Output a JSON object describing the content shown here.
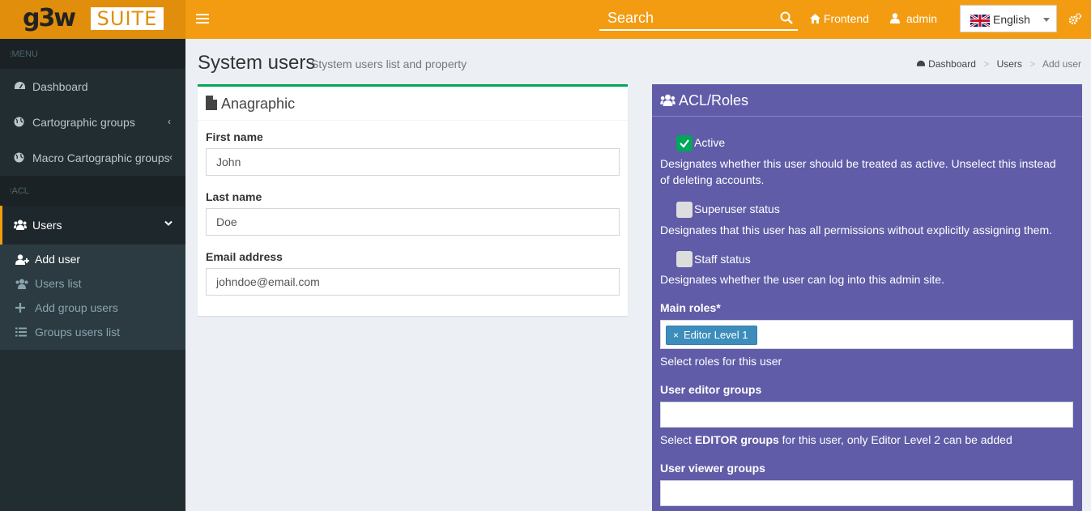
{
  "header": {
    "logo_main": "g3w",
    "logo_suite": "SUITE",
    "search_placeholder": "Search",
    "frontend_label": "Frontend",
    "user_label": "admin",
    "language": "English"
  },
  "sidebar": {
    "menu_header": "MENU",
    "acl_header": "ACL",
    "items": [
      {
        "label": "Dashboard",
        "icon": "dashboard-icon"
      },
      {
        "label": "Cartographic groups",
        "icon": "globe-icon"
      },
      {
        "label": "Macro Cartographic groups",
        "icon": "globe-icon"
      }
    ],
    "users": {
      "label": "Users",
      "icon": "users-icon"
    },
    "sub_items": [
      {
        "label": "Add user",
        "icon": "user-plus-icon"
      },
      {
        "label": "Users list",
        "icon": "users-icon"
      },
      {
        "label": "Add group users",
        "icon": "plus-icon"
      },
      {
        "label": "Groups users list",
        "icon": "list-icon"
      }
    ]
  },
  "page": {
    "title": "System users",
    "subtitle": "Stystem users list and property",
    "breadcrumb": [
      "Dashboard",
      "Users",
      "Add user"
    ]
  },
  "anagraphic": {
    "title": "Anagraphic",
    "first_name_label": "First name",
    "first_name_value": "John",
    "last_name_label": "Last name",
    "last_name_value": "Doe",
    "email_label": "Email address",
    "email_value": "johndoe@email.com"
  },
  "acl": {
    "title": "ACL/Roles",
    "active_label": "Active",
    "active_checked": true,
    "active_help": "Designates whether this user should be treated as active. Unselect this instead of deleting accounts.",
    "superuser_label": "Superuser status",
    "superuser_checked": false,
    "superuser_help": "Designates that this user has all permissions without explicitly assigning them.",
    "staff_label": "Staff status",
    "staff_checked": false,
    "staff_help": "Designates whether the user can log into this admin site.",
    "main_roles_label": "Main roles*",
    "main_roles_tag": "Editor Level 1",
    "main_roles_help": "Select roles for this user",
    "editor_groups_label": "User editor groups",
    "editor_help_prefix": "Select ",
    "editor_help_bold": "EDITOR groups",
    "editor_help_suffix": " for this user, only Editor Level 2 can be added",
    "viewer_groups_label": "User viewer groups"
  },
  "colors": {
    "header": "#f39c12",
    "sidebar": "#222d32",
    "acl_box": "#605ca8",
    "success": "#00a65a",
    "tag": "#3c8dbc"
  }
}
